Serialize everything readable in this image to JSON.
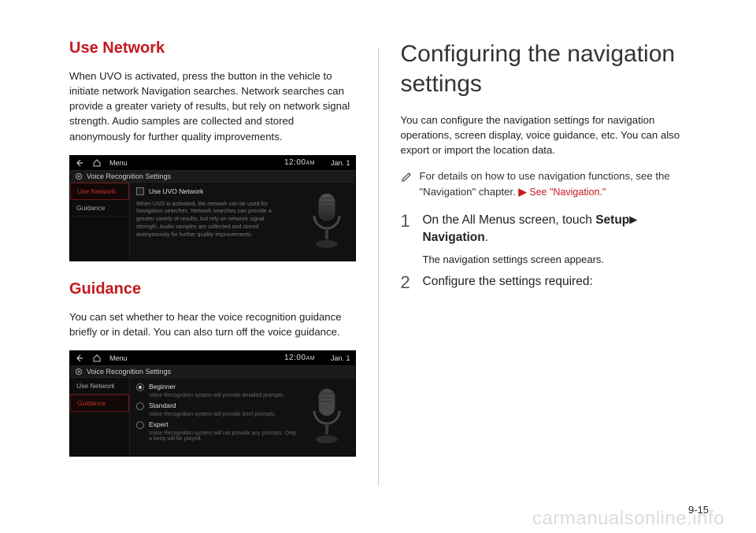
{
  "left": {
    "section1": {
      "title": "Use Network",
      "body": "When UVO is activated, press the button in the vehicle to initiate network Navigation searches. Network searches can provide a greater variety of results, but rely on network signal strength. Audio samples are collected and stored anonymously for further quality improvements."
    },
    "section2": {
      "title": "Guidance",
      "body": "You can set whether to hear the voice recognition guidance briefly or in detail. You can also turn off the voice guidance."
    },
    "shot_common": {
      "menu": "Menu",
      "clock": "12:00",
      "ampm": "AM",
      "date": "Jan. 1",
      "settings_title": "Voice Recognition Settings",
      "side": [
        "Use Network",
        "Guidance"
      ]
    },
    "shot1": {
      "checkbox_label": "Use UVO Network",
      "desc": "When UVO is activated, the network can be used for Navigation searches.\nNetwork searches can provide a greater variety of results, but rely on network signal strength.\nAudio samples are collected and stored anonymously for further quality improvements."
    },
    "shot2": {
      "options": [
        {
          "label": "Beginner",
          "sub": "Voice Recognition system will provide detailed prompts."
        },
        {
          "label": "Standard",
          "sub": "Voice Recognition system will provide brief prompts."
        },
        {
          "label": "Expert",
          "sub": "Voice Recognition system will not provide any prompts. Only a beep will be played."
        }
      ]
    }
  },
  "right": {
    "title": "Configuring the navigation settings",
    "intro": "You can configure the navigation settings for navigation operations, screen display, voice guidance, etc. You can also export or import the location data.",
    "note": "For details on how to use navigation functions, see the \"Navigation\" chapter. ",
    "note_ref_caret": "▶",
    "note_ref": "See \"Navigation.\"",
    "steps": [
      {
        "num": "1",
        "line_a": "On the All Menus screen, touch ",
        "bold_a": "Setup",
        "caret": " ▶ ",
        "bold_b": "Navigation",
        "tail": ".",
        "sub": "The navigation settings screen appears."
      },
      {
        "num": "2",
        "line_a": "Configure the settings required:",
        "bold_a": "",
        "caret": "",
        "bold_b": "",
        "tail": "",
        "sub": ""
      }
    ]
  },
  "page_num": "9-15",
  "watermark": "carmanualsonline.info"
}
